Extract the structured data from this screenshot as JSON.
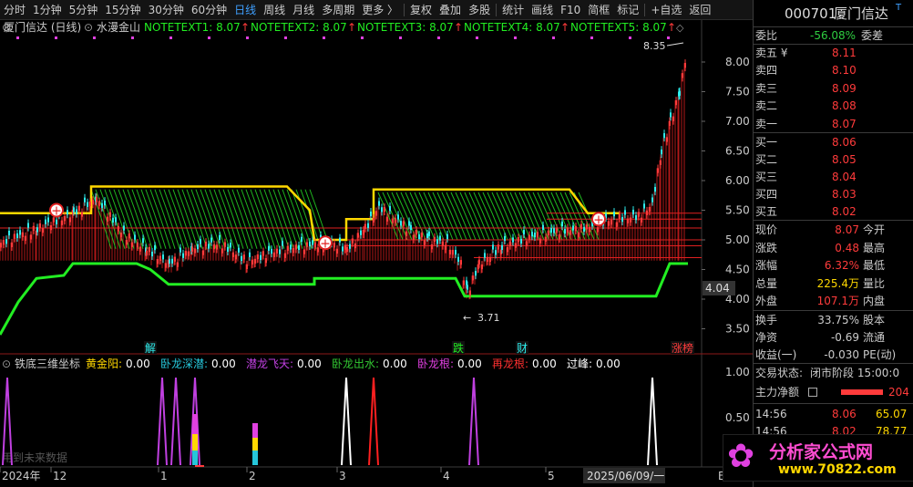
{
  "toolbar": {
    "items": [
      "分时",
      "1分钟",
      "5分钟",
      "15分钟",
      "30分钟",
      "60分钟",
      "日线",
      "周线",
      "月线",
      "多周期",
      "更多 〉",
      "复权",
      "叠加",
      "多股",
      "统计",
      "画线",
      "F10",
      "简框",
      "标记",
      "+自选",
      "返回"
    ],
    "selected": "日线"
  },
  "main_header": {
    "stock": "厦门信达 (日线)",
    "indicator": "水漫金山",
    "notes": [
      "NOTETEXT1: 8.07",
      "NOTETEXT2: 8.07",
      "NOTETEXT3: 8.07",
      "NOTETEXT4: 8.07",
      "NOTETEXT5: 8.07"
    ],
    "note_arrow": "↑"
  },
  "price_axis": {
    "ticks": [
      "8.00",
      "7.50",
      "7.00",
      "6.50",
      "6.00",
      "5.50",
      "5.00",
      "4.50",
      "4.00",
      "3.50"
    ],
    "current_tag": "4.04"
  },
  "annotations": {
    "high": "8.35",
    "low": "3.71",
    "events": [
      "解",
      "跌",
      "财",
      "涨榜"
    ]
  },
  "sub_header": {
    "name": "铁底三维坐标",
    "items": [
      {
        "label": "黄金阳:",
        "value": "0.00",
        "color": "#ffd700"
      },
      {
        "label": "卧龙深潜:",
        "value": "0.00",
        "color": "#26c6da"
      },
      {
        "label": "潜龙飞天:",
        "value": "0.00",
        "color": "#c040e0"
      },
      {
        "label": "卧龙出水:",
        "value": "0.00",
        "color": "#32c832"
      },
      {
        "label": "卧龙根:",
        "value": "0.00",
        "color": "#e040e0"
      },
      {
        "label": "再龙根:",
        "value": "0.00",
        "color": "#ff3030"
      },
      {
        "label": "过峰:",
        "value": "0.00",
        "color": "#ffffff"
      }
    ],
    "warning": "用到未来数据",
    "axis": [
      "1.00",
      "0.50"
    ]
  },
  "date_axis": {
    "labels": [
      "2024年",
      "12",
      "1",
      "2",
      "3",
      "4",
      "5"
    ],
    "current": "2025/06/09/一",
    "right": "E"
  },
  "quote": {
    "code": "000701",
    "name": "厦门信达",
    "badge": "T",
    "weibi_label": "委比",
    "weibi_value": "-56.08%",
    "weicha_label": "委差",
    "sell": [
      {
        "label": "卖五 ¥",
        "price": "8.11"
      },
      {
        "label": "卖四",
        "price": "8.10"
      },
      {
        "label": "卖三",
        "price": "8.09"
      },
      {
        "label": "卖二",
        "price": "8.08"
      },
      {
        "label": "卖一",
        "price": "8.07"
      }
    ],
    "buy": [
      {
        "label": "买一",
        "price": "8.06"
      },
      {
        "label": "买二",
        "price": "8.05"
      },
      {
        "label": "买三",
        "price": "8.04"
      },
      {
        "label": "买四",
        "price": "8.03"
      },
      {
        "label": "买五",
        "price": "8.02"
      }
    ],
    "stats": [
      {
        "l1": "现价",
        "v1": "8.07",
        "c1": "#ff3b3b",
        "l2": "今开"
      },
      {
        "l1": "涨跌",
        "v1": "0.48",
        "c1": "#ff3b3b",
        "l2": "最高"
      },
      {
        "l1": "涨幅",
        "v1": "6.32%",
        "c1": "#ff3b3b",
        "l2": "最低"
      },
      {
        "l1": "总量",
        "v1": "225.4万",
        "c1": "#ffd700",
        "l2": "量比"
      },
      {
        "l1": "外盘",
        "v1": "107.1万",
        "c1": "#ff3b3b",
        "l2": "内盘"
      }
    ],
    "stats2": [
      {
        "l1": "换手",
        "v1": "33.75%",
        "l2": "股本"
      },
      {
        "l1": "净资",
        "v1": "-0.69",
        "l2": "流通"
      },
      {
        "l1": "收益(一)",
        "v1": "-0.030",
        "l2": "PE(动)"
      }
    ],
    "status_label": "交易状态:",
    "status_value": "闭市阶段 15:00:0",
    "flow_label": "主力净额",
    "flow_value": "204",
    "ticks": [
      {
        "time": "14:56",
        "price": "8.06",
        "vol": "65.07"
      },
      {
        "time": "14:56",
        "price": "8.02",
        "vol": "78.77"
      }
    ]
  },
  "watermark": {
    "title": "分析家公式网",
    "url": "www.70822.com"
  },
  "colors": {
    "up": "#ff3b3b",
    "down": "#2eeeee",
    "gold": "#ffd700",
    "green": "#22ee22",
    "selected": "#3fa0ff"
  }
}
